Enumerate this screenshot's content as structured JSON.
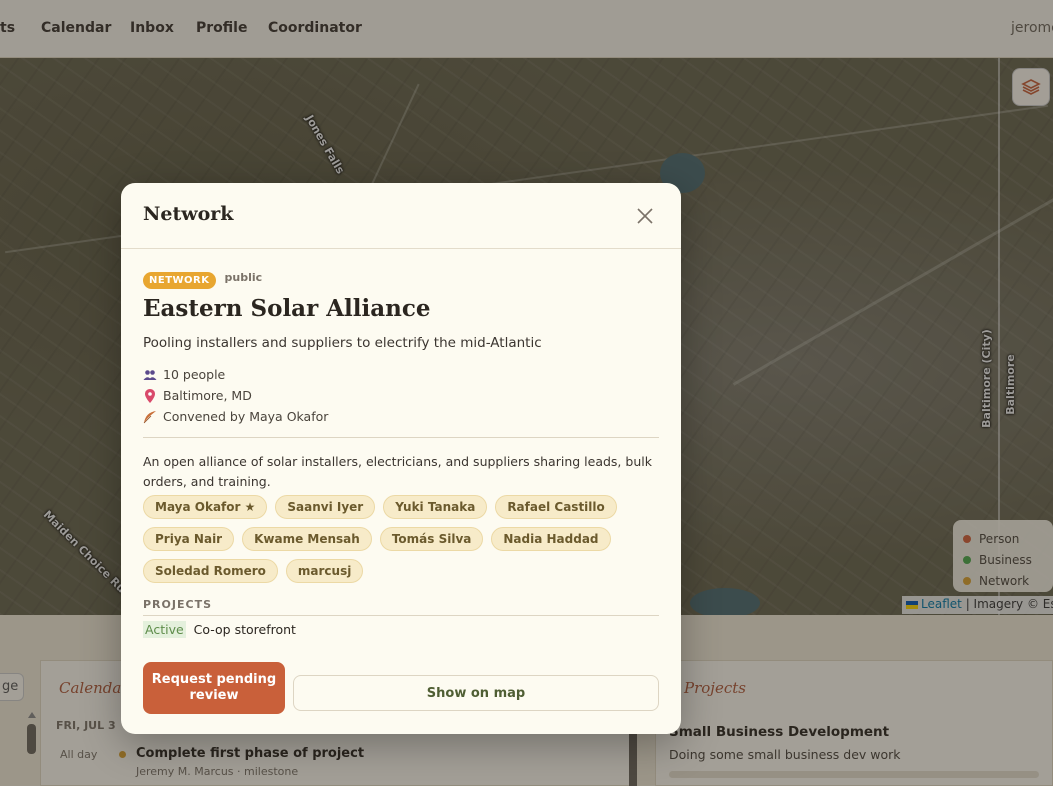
{
  "nav": {
    "items": [
      "ts",
      "Calendar",
      "Inbox",
      "Profile",
      "Coordinator"
    ],
    "user": "jerome"
  },
  "map": {
    "labels": [
      "Jones Falls",
      "Baltimore (City)",
      "Baltimore",
      "Maiden Choice Run"
    ],
    "legend": [
      {
        "label": "Person",
        "color": "#d0603a"
      },
      {
        "label": "Business",
        "color": "#4aa84a"
      },
      {
        "label": "Network",
        "color": "#d9a030"
      }
    ],
    "attribution": {
      "leaflet": "Leaflet",
      "rest": "| Imagery © Esri"
    }
  },
  "bottom": {
    "left_pill": "ge",
    "calendar": {
      "title": "Calendar",
      "day": "FRI, JUL 3",
      "event_time": "All day",
      "event_title": "Complete first phase of project",
      "event_meta": "Jeremy M. Marcus · milestone"
    },
    "projects": {
      "title": "Projects",
      "item_title": "Small Business Development",
      "item_desc": "Doing some small business dev work"
    }
  },
  "modal": {
    "title": "Network",
    "badge": "NETWORK",
    "visibility": "public",
    "name": "Eastern Solar Alliance",
    "tagline": "Pooling installers and suppliers to electrify the mid-Atlantic",
    "people": "10 people",
    "location": "Baltimore, MD",
    "convener": "Convened by Maya Okafor",
    "description": "An open alliance of solar installers, electricians, and suppliers sharing leads, bulk orders, and training.",
    "members": [
      "Maya Okafor ★",
      "Saanvi Iyer",
      "Yuki Tanaka",
      "Rafael Castillo",
      "Priya Nair",
      "Kwame Mensah",
      "Tomás Silva",
      "Nadia Haddad",
      "Soledad Romero",
      "marcusj"
    ],
    "projects_label": "PROJECTS",
    "project_status": "Active",
    "project_name": "Co-op storefront",
    "request_button": "Request pending review",
    "show_map_button": "Show on map"
  },
  "colors": {
    "accent": "#c9603a",
    "badge": "#e8a630",
    "chip_bg": "#f7ebc9"
  }
}
